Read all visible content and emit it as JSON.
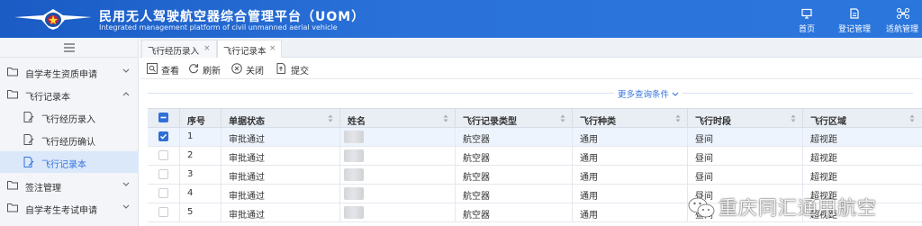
{
  "header": {
    "title_cn": "民用无人驾驶航空器综合管理平台（UOM）",
    "title_en": "Integrated management platform of civil unmanned aerial vehicle",
    "nav": [
      {
        "label": "首页",
        "icon": "monitor-icon"
      },
      {
        "label": "登记管理",
        "icon": "document-icon"
      },
      {
        "label": "适航管理",
        "icon": "drone-icon"
      }
    ]
  },
  "sidebar": {
    "items": [
      {
        "label": "自学考生资质申请",
        "icon": "folder-icon",
        "expanded": false
      },
      {
        "label": "飞行记录本",
        "icon": "folder-icon",
        "expanded": true
      },
      {
        "label": "飞行经历录入",
        "icon": "file-edit-icon"
      },
      {
        "label": "飞行经历确认",
        "icon": "file-edit-icon"
      },
      {
        "label": "飞行记录本",
        "icon": "file-edit-icon",
        "active": true
      },
      {
        "label": "签注管理",
        "icon": "folder-icon",
        "expanded": false
      },
      {
        "label": "自学考生考试申请",
        "icon": "folder-icon",
        "expanded": false
      }
    ]
  },
  "tabs": [
    {
      "label": "飞行经历录入",
      "close": "×"
    },
    {
      "label": "飞行记录本",
      "close": "×",
      "active": true
    }
  ],
  "toolbar": {
    "view": "查看",
    "refresh": "刷新",
    "close": "关闭",
    "submit": "提交"
  },
  "more_query": "更多查询条件",
  "table": {
    "columns": [
      "序号",
      "单据状态",
      "姓名",
      "飞行记录类型",
      "飞行种类",
      "飞行时段",
      "飞行区域"
    ],
    "rows": [
      {
        "no": "1",
        "status": "审批通过",
        "name": "",
        "type": "航空器",
        "kind": "通用",
        "period": "昼间",
        "area": "超视距",
        "checked": true
      },
      {
        "no": "2",
        "status": "审批通过",
        "name": "",
        "type": "航空器",
        "kind": "通用",
        "period": "昼间",
        "area": "超视距",
        "checked": false
      },
      {
        "no": "3",
        "status": "审批通过",
        "name": "",
        "type": "航空器",
        "kind": "通用",
        "period": "昼间",
        "area": "超视距",
        "checked": false
      },
      {
        "no": "4",
        "status": "审批通过",
        "name": "",
        "type": "航空器",
        "kind": "通用",
        "period": "昼间",
        "area": "超视距",
        "checked": false
      },
      {
        "no": "5",
        "status": "审批通过",
        "name": "",
        "type": "航空器",
        "kind": "通用",
        "period": "昼间",
        "area": "超视距",
        "checked": false
      }
    ]
  },
  "watermark": "重庆同汇通用航空",
  "colors": {
    "header_blue": "#2a72da",
    "accent": "#3574dd",
    "checkbox": "#2f6fd6",
    "active_item_bg": "#dbe8fa"
  }
}
